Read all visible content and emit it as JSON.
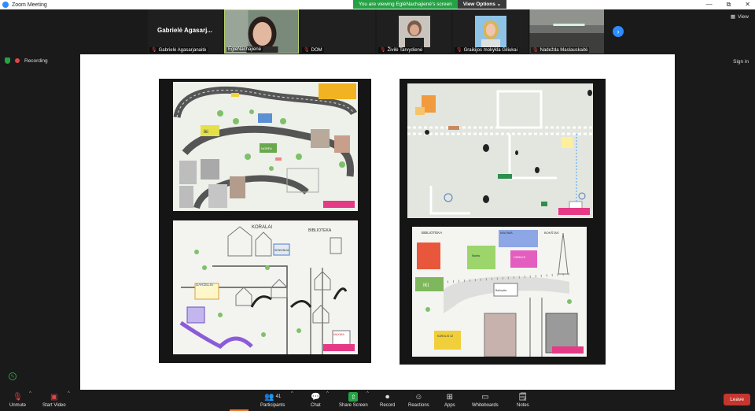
{
  "window": {
    "title": "Zoom Meeting",
    "controls": [
      "—",
      "❐",
      "⧉",
      "✕"
    ]
  },
  "banner": {
    "viewing": "You are viewing EglėNachajienė's screen",
    "options": "View Options ⌄"
  },
  "gallery": [
    {
      "name": "Gabrielė Agasarjanaitė",
      "big_label": "Gabrielė  Agasarj...",
      "muted": true
    },
    {
      "name": "EglėNachajienė",
      "muted": false
    },
    {
      "name": "DOM",
      "muted": true
    },
    {
      "name": "Živilė Tarvydienė",
      "muted": true
    },
    {
      "name": "Graikijos mokykla Giliukai",
      "muted": true
    },
    {
      "name": "Nadežda Maslauskaitė",
      "muted": true
    }
  ],
  "view_label": "View",
  "status": {
    "recording": "Recording"
  },
  "signin": "Sign in",
  "drawings": {
    "top_left": {
      "signs": [
        "iki",
        "NORFA"
      ]
    },
    "bottom_left": {
      "signs": [
        "KORALAI",
        "BIBLIOTEKA",
        "DARŽELIS",
        "MAXIMA",
        "SENIŪNIJA"
      ]
    },
    "bottom_right": {
      "signs": [
        "BIBLIOTEKA",
        "MAXIMA",
        "BOKŠTAS",
        "Norfa",
        "IKI",
        "CIRKUS",
        "KAROLIS 32",
        "Bažnyčia"
      ]
    }
  },
  "toolbar": {
    "unmute": "Unmute",
    "video": "Start Video",
    "participants": "Participants",
    "participants_count": "41",
    "chat": "Chat",
    "share": "Share Screen",
    "record": "Record",
    "reactions": "Reactions",
    "apps": "Apps",
    "whiteboards": "Whiteboards",
    "notes": "Notes",
    "leave": "Leave"
  },
  "colors": {
    "accent": "#2d8cff",
    "share_green": "#25a244",
    "leave_red": "#c5362f",
    "muted_red": "#e24545",
    "tag_pink": "#e53a86"
  }
}
